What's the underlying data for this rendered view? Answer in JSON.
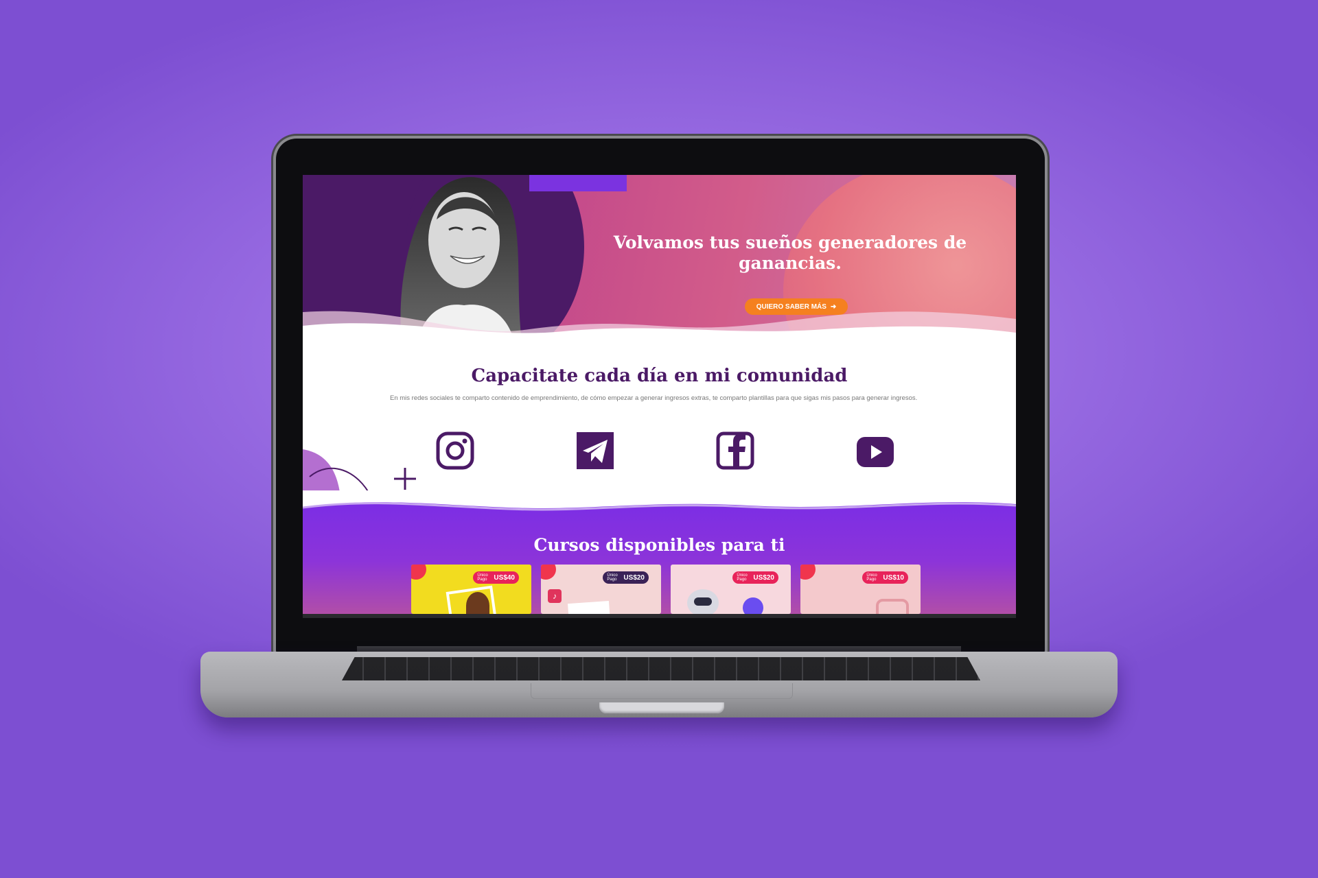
{
  "hero": {
    "title": "Volvamos tus sueños generadores de ganancias.",
    "cta_label": "QUIERO SABER MÁS"
  },
  "community": {
    "title": "Capacitate cada día en mi comunidad",
    "text": "En mis redes sociales te comparto contenido de emprendimiento, de cómo empezar a generar ingresos extras, te comparto plantillas para que sigas mis pasos para generar ingresos.",
    "socials": [
      {
        "icon": "instagram-icon"
      },
      {
        "icon": "telegram-icon"
      },
      {
        "icon": "facebook-icon"
      },
      {
        "icon": "youtube-icon"
      }
    ]
  },
  "courses": {
    "title": "Cursos disponibles para ti",
    "items": [
      {
        "badge_small": "Único Pago",
        "price": "US$40",
        "bg": "#f2dc1f"
      },
      {
        "badge_small": "Único Pago",
        "price": "US$20",
        "bg": "#f4d6d6"
      },
      {
        "badge_small": "Único Pago",
        "price": "US$20",
        "bg": "#f7d8de"
      },
      {
        "badge_small": "Único Pago",
        "price": "US$10",
        "bg": "#f4c9cc"
      }
    ]
  },
  "colors": {
    "brand_purple": "#4b1a66",
    "accent_orange": "#f5801f",
    "section_purple": "#7a2de6"
  }
}
